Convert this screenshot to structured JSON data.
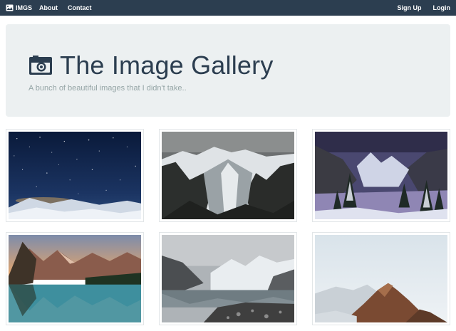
{
  "nav": {
    "brand": "IMGS",
    "links": [
      "About",
      "Contact"
    ],
    "right_links": [
      "Sign Up",
      "Login"
    ]
  },
  "hero": {
    "title": "The Image Gallery",
    "subtitle": "A bunch of beautiful images that I didn't take.."
  },
  "colors": {
    "navbar": "#2c3e50",
    "jumbotron": "#ecf0f1",
    "title": "#2c3e50",
    "subtitle": "#95a5a6"
  },
  "gallery": [
    {
      "subject": "starry night sky over snowy landscape"
    },
    {
      "subject": "glacier valley between mountains"
    },
    {
      "subject": "snowy forest valley with peaks"
    },
    {
      "subject": "mountain lake at sunset"
    },
    {
      "subject": "glacial lake with rocky shore"
    },
    {
      "subject": "misty mountain peak"
    }
  ]
}
